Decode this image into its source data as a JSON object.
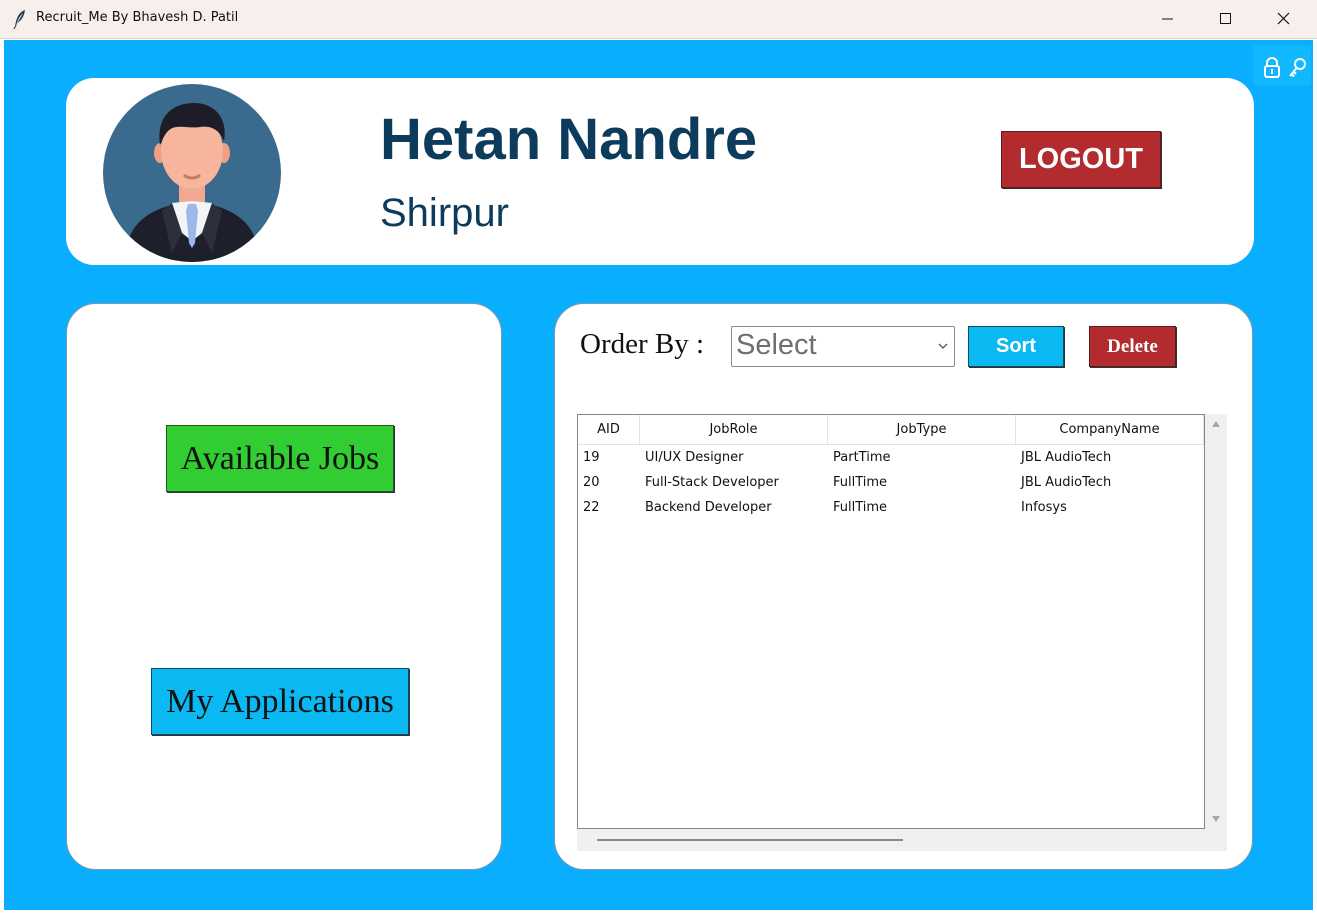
{
  "window": {
    "title": "Recruit_Me By Bhavesh D. Patil"
  },
  "header": {
    "user_name": "Hetan Nandre",
    "user_city": "Shirpur",
    "logout_label": "LOGOUT"
  },
  "sidebar": {
    "available_jobs_label": "Available Jobs",
    "my_applications_label": "My Applications"
  },
  "toolbar": {
    "order_by_label": "Order By :",
    "select_value": "Select",
    "sort_label": "Sort",
    "delete_label": "Delete"
  },
  "table": {
    "columns": [
      "AID",
      "JobRole",
      "JobType",
      "CompanyName"
    ],
    "rows": [
      [
        "19",
        "UI/UX Designer",
        "PartTime",
        "JBL AudioTech"
      ],
      [
        "20",
        "Full-Stack Developer",
        "FullTime",
        "JBL AudioTech"
      ],
      [
        "22",
        "Backend Developer",
        "FullTime",
        "Infosys"
      ]
    ]
  },
  "colors": {
    "background": "#0aaeff",
    "card": "#ffffff",
    "name_text": "#0d3b5c",
    "logout": "#b22b2f",
    "available_jobs": "#32cd32",
    "my_applications": "#0ab9f2",
    "sort": "#0ab9f2",
    "delete": "#b22b2f"
  },
  "icons": {
    "app": "feather-icon",
    "minimize": "minimize-icon",
    "maximize": "maximize-icon",
    "close": "close-icon",
    "lock": "lock-icon",
    "key": "key-icon",
    "avatar": "user-avatar-icon",
    "select_chevron": "chevron-down-icon"
  }
}
